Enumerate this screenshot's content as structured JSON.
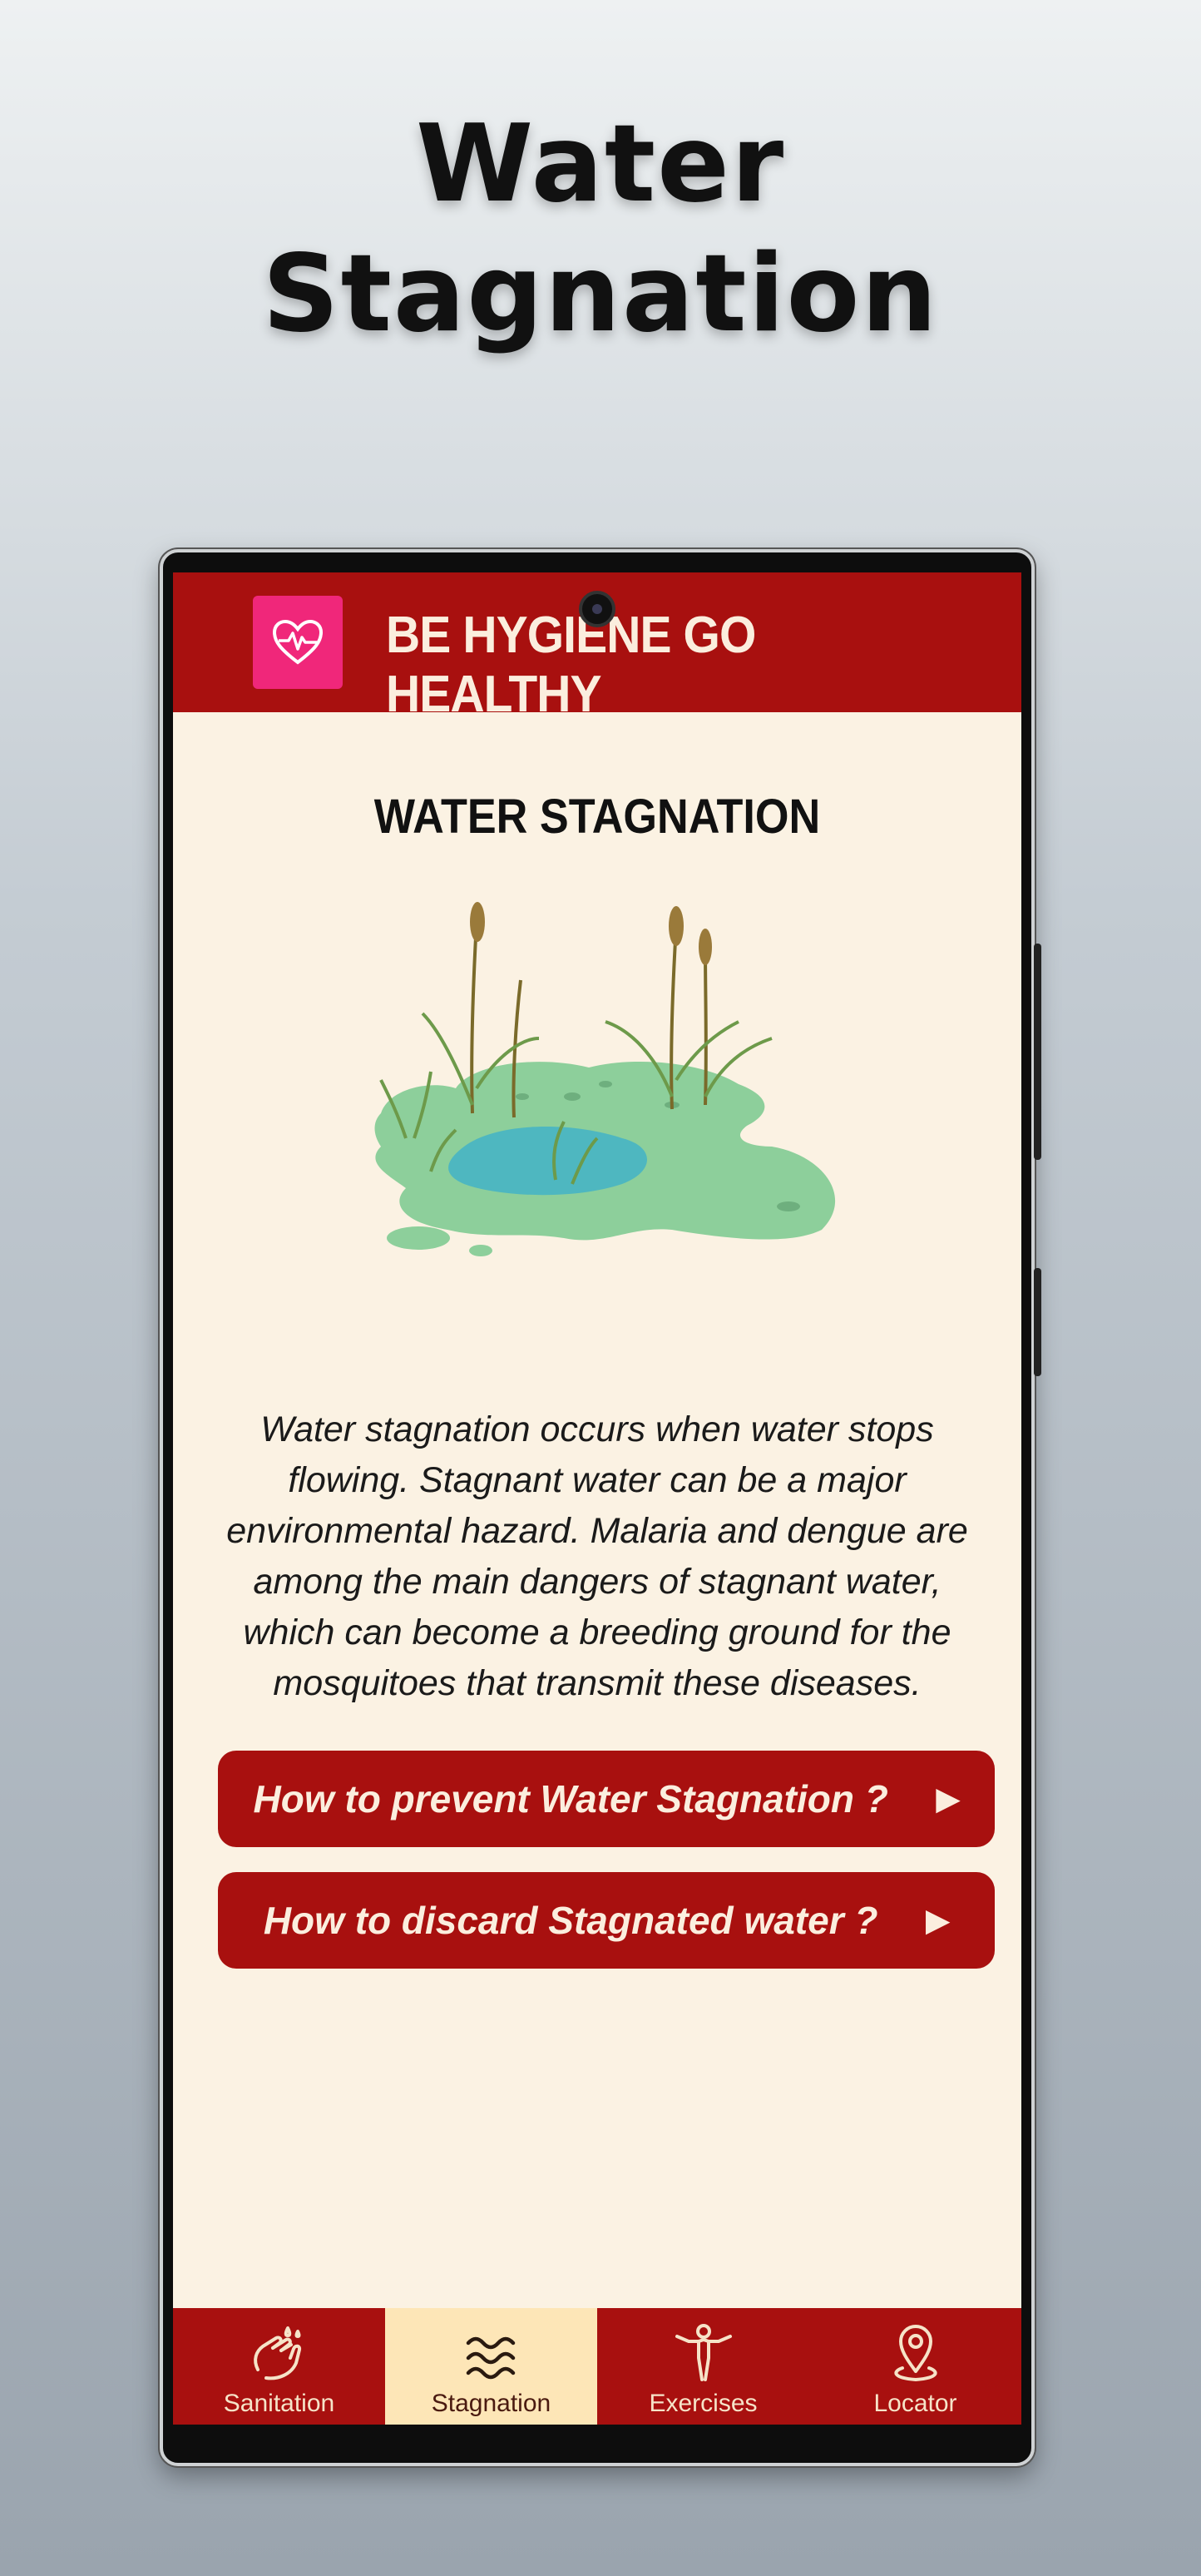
{
  "hero": {
    "title_line1": "Water",
    "title_line2": "Stagnation"
  },
  "app": {
    "title": "BE HYGIENE GO HEALTHY",
    "logo_icon": "heart-pulse-icon",
    "bar_color": "#a8100f",
    "logo_color": "#f0277a"
  },
  "page": {
    "heading": "WATER STAGNATION",
    "illustration": "stagnant-pond-icon",
    "description": "Water stagnation occurs when water stops flowing. Stagnant water can be a major environmental hazard. Malaria and dengue are among the main dangers of stagnant water, which can become a breeding ground for the mosquitoes that transmit these diseases.",
    "buttons": [
      {
        "label": "How to prevent Water Stagnation ?",
        "icon": "play-arrow-icon"
      },
      {
        "label": "How to discard Stagnated water ?",
        "icon": "play-arrow-icon"
      }
    ]
  },
  "nav": {
    "items": [
      {
        "label": "Sanitation",
        "icon": "hand-wash-icon",
        "active": false
      },
      {
        "label": "Stagnation",
        "icon": "water-waves-icon",
        "active": true
      },
      {
        "label": "Exercises",
        "icon": "exercise-person-icon",
        "active": false
      },
      {
        "label": "Locator",
        "icon": "location-pin-icon",
        "active": false
      }
    ],
    "active_color": "#fde6b7"
  }
}
